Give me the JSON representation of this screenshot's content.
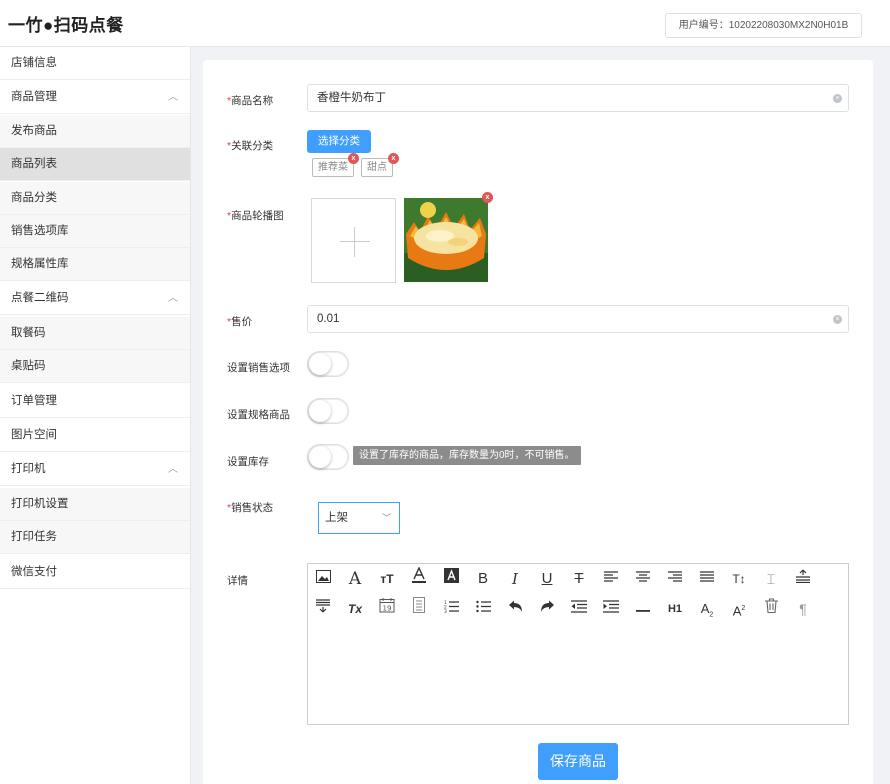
{
  "header": {
    "logo": "一竹●扫码点餐",
    "user_id": "用户编号：10202208030MX2N0H01B"
  },
  "sidebar": {
    "items": [
      {
        "label": "店铺信息",
        "type": "group"
      },
      {
        "label": "商品管理",
        "type": "group",
        "chevron": "chevron-up-icon"
      },
      {
        "label": "发布商品",
        "type": "sub"
      },
      {
        "label": "商品列表",
        "type": "sub",
        "active": true
      },
      {
        "label": "商品分类",
        "type": "sub"
      },
      {
        "label": "销售选项库",
        "type": "sub"
      },
      {
        "label": "规格属性库",
        "type": "sub"
      },
      {
        "label": "点餐二维码",
        "type": "group",
        "chevron": "chevron-up-icon"
      },
      {
        "label": "取餐码",
        "type": "sub"
      },
      {
        "label": "桌贴码",
        "type": "sub"
      },
      {
        "label": "订单管理",
        "type": "group"
      },
      {
        "label": "图片空间",
        "type": "group"
      },
      {
        "label": "打印机",
        "type": "group",
        "chevron": "chevron-up-icon"
      },
      {
        "label": "打印机设置",
        "type": "sub"
      },
      {
        "label": "打印任务",
        "type": "sub"
      },
      {
        "label": "微信支付",
        "type": "group"
      }
    ]
  },
  "form": {
    "name_label": "商品名称",
    "name_value": "香橙牛奶布丁",
    "category_label": "关联分类",
    "category_button": "选择分类",
    "category_tags": [
      "推荐菜",
      "甜点"
    ],
    "carousel_label": "商品轮播图",
    "price_label": "售价",
    "price_value": "0.01",
    "sale_options_label": "设置销售选项",
    "spec_label": "设置规格商品",
    "stock_label": "设置库存",
    "stock_tooltip": "设置了库存的商品，库存数量为0时，不可销售。",
    "status_label": "销售状态",
    "status_value": "上架",
    "detail_label": "详情",
    "save_button": "保存商品",
    "required_mark": "*"
  },
  "editor": {
    "toolbar_row1": [
      "image-icon",
      "font-family-icon",
      "font-size-icon",
      "font-color-icon",
      "bg-color-icon",
      "bold-icon",
      "italic-icon",
      "underline-icon",
      "strikethrough-icon",
      "align-left-icon",
      "align-center-icon",
      "align-right-icon",
      "align-justify-icon",
      "line-height-icon",
      "letter-spacing-icon",
      "indent-top-icon"
    ],
    "toolbar_row2": [
      "indent-bottom-icon",
      "clear-format-icon",
      "date-icon",
      "template-icon",
      "ordered-list-icon",
      "unordered-list-icon",
      "undo-icon",
      "redo-icon",
      "outdent-icon",
      "indent-icon",
      "horizontal-rule-icon",
      "heading-icon",
      "subscript-icon",
      "superscript-icon",
      "delete-icon",
      "paragraph-icon"
    ],
    "glyphs": {
      "bold": "B",
      "italic": "I",
      "underline": "U",
      "strike": "T",
      "heading": "H1",
      "font": "A",
      "clear": "Tx"
    }
  }
}
